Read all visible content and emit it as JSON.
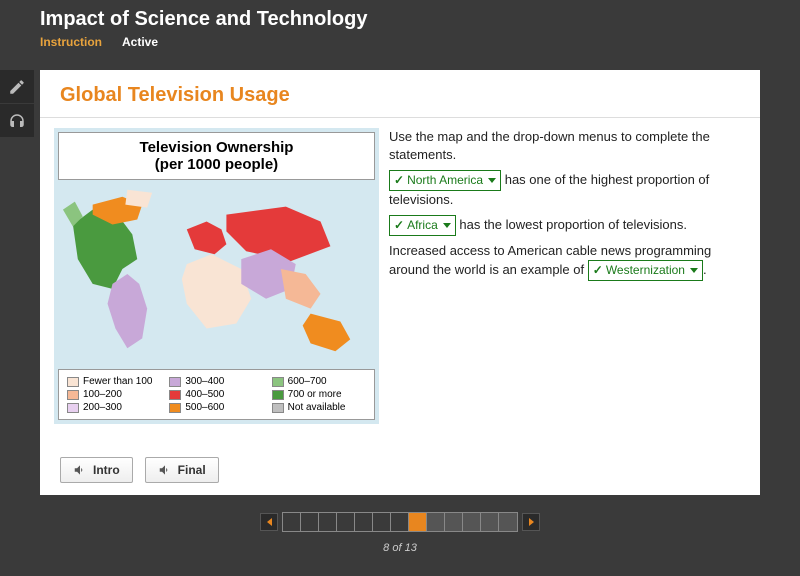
{
  "header": {
    "title": "Impact of Science and Technology",
    "tab_instruction": "Instruction",
    "tab_active": "Active"
  },
  "content": {
    "title": "Global Television Usage"
  },
  "map": {
    "title_l1": "Television Ownership",
    "title_l2": "(per 1000 people)"
  },
  "legend": [
    {
      "label": "Fewer than 100",
      "color": "#f9e4d4"
    },
    {
      "label": "300–400",
      "color": "#c8a8d8"
    },
    {
      "label": "600–700",
      "color": "#8bc47f"
    },
    {
      "label": "100–200",
      "color": "#f5b896"
    },
    {
      "label": "400–500",
      "color": "#e43a3a"
    },
    {
      "label": "700 or more",
      "color": "#4a9a3f"
    },
    {
      "label": "200–300",
      "color": "#e8d0f0"
    },
    {
      "label": "500–600",
      "color": "#f08c1f"
    },
    {
      "label": "Not available",
      "color": "#bfbfbf"
    }
  ],
  "questions": {
    "intro": "Use the map and the drop-down menus to complete the statements.",
    "s1_sel": "North America",
    "s1_after": "has one of the highest proportion of televisions.",
    "s2_sel": "Africa",
    "s2_after": "has the lowest proportion of televisions.",
    "s3_before": "Increased access to American cable news programming around the world is an example of",
    "s3_sel": "Westernization",
    "s3_after": "."
  },
  "audio": {
    "intro": "Intro",
    "final": "Final"
  },
  "pager": {
    "current": 8,
    "total": 13,
    "label": "8 of 13"
  }
}
